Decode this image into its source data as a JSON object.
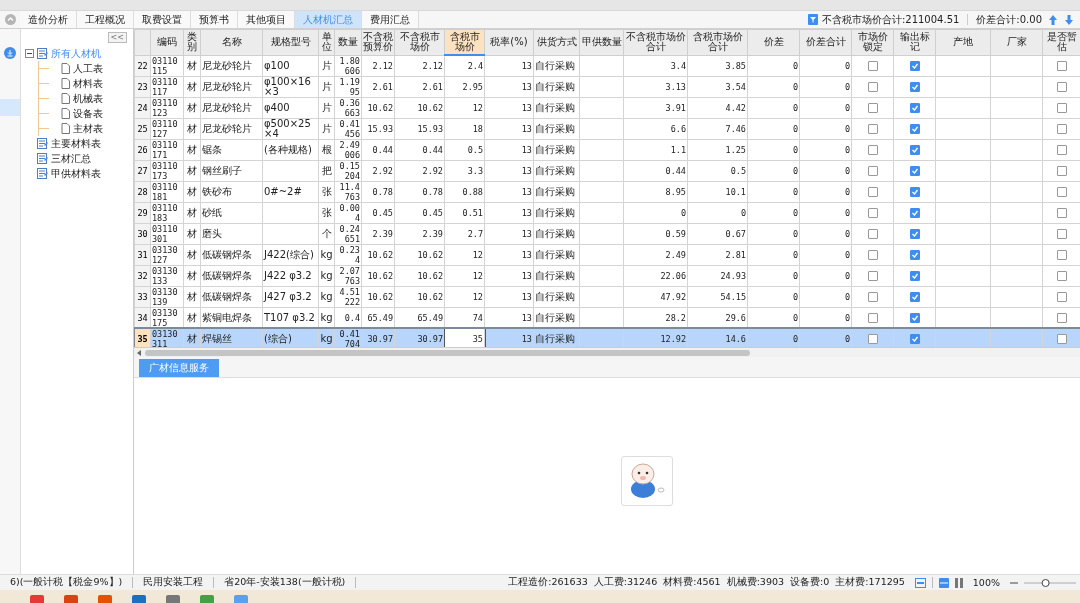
{
  "tabs": [
    {
      "label": "造价分析",
      "selected": false
    },
    {
      "label": "工程概况",
      "selected": false
    },
    {
      "label": "取费设置",
      "selected": false
    },
    {
      "label": "预算书",
      "selected": false
    },
    {
      "label": "其他项目",
      "selected": false
    },
    {
      "label": "人材机汇总",
      "selected": true
    },
    {
      "label": "费用汇总",
      "selected": false
    }
  ],
  "summary": {
    "market_total": "不含税市场价合计:211004.51",
    "diff_total": "价差合计:0.00"
  },
  "tree": {
    "collapse": "<<",
    "items": [
      {
        "label": "所有人材机",
        "selected": true,
        "expanded": true,
        "children": [
          {
            "label": "人工表",
            "selected": false
          },
          {
            "label": "材料表",
            "selected": false
          },
          {
            "label": "机械表",
            "selected": false
          },
          {
            "label": "设备表",
            "selected": false
          },
          {
            "label": "主材表",
            "selected": false
          }
        ]
      },
      {
        "label": "主要材料表",
        "selected": false
      },
      {
        "label": "三材汇总",
        "selected": false
      },
      {
        "label": "甲供材料表",
        "selected": false
      }
    ]
  },
  "table": {
    "columns": [
      {
        "label": "编码",
        "selected": false
      },
      {
        "label": "类别",
        "selected": false
      },
      {
        "label": "名称",
        "selected": false
      },
      {
        "label": "规格型号",
        "selected": false
      },
      {
        "label": "单位",
        "selected": false
      },
      {
        "label": "数量",
        "selected": false
      },
      {
        "label": "不含税预算价",
        "selected": false
      },
      {
        "label": "不含税市场价",
        "selected": false
      },
      {
        "label": "含税市场价",
        "selected": true
      },
      {
        "label": "税率(%)",
        "selected": false
      },
      {
        "label": "供货方式",
        "selected": false
      },
      {
        "label": "甲供数量",
        "selected": false
      },
      {
        "label": "不含税市场价合计",
        "selected": false
      },
      {
        "label": "含税市场价合计",
        "selected": false
      },
      {
        "label": "价差",
        "selected": false
      },
      {
        "label": "价差合计",
        "selected": false
      },
      {
        "label": "市场价锁定",
        "selected": false
      },
      {
        "label": "输出标记",
        "selected": false
      },
      {
        "label": "产地",
        "selected": false
      },
      {
        "label": "厂家",
        "selected": false
      },
      {
        "label": "是否暂估",
        "selected": false
      }
    ],
    "rows": [
      {
        "no": "22",
        "code": "03110115",
        "type": "材",
        "name": "尼龙砂轮片",
        "spec": "φ100",
        "unit": "片",
        "qty": "1.80606",
        "budget": "2.12",
        "market": "2.12",
        "market_tax": "2.4",
        "rate": "13",
        "supply": "自行采购",
        "total": "3.4",
        "total_tax": "3.85",
        "diff": "0",
        "diff_total": "0",
        "locked": false,
        "output": true,
        "provisional": false,
        "selected": false
      },
      {
        "no": "23",
        "code": "03110117",
        "type": "材",
        "name": "尼龙砂轮片",
        "spec": "φ100×16×3",
        "unit": "片",
        "qty": "1.1995",
        "budget": "2.61",
        "market": "2.61",
        "market_tax": "2.95",
        "rate": "13",
        "supply": "自行采购",
        "total": "3.13",
        "total_tax": "3.54",
        "diff": "0",
        "diff_total": "0",
        "locked": false,
        "output": true,
        "provisional": false,
        "selected": false
      },
      {
        "no": "24",
        "code": "03110123",
        "type": "材",
        "name": "尼龙砂轮片",
        "spec": "φ400",
        "unit": "片",
        "qty": "0.36663",
        "budget": "10.62",
        "market": "10.62",
        "market_tax": "12",
        "rate": "13",
        "supply": "自行采购",
        "total": "3.91",
        "total_tax": "4.42",
        "diff": "0",
        "diff_total": "0",
        "locked": false,
        "output": true,
        "provisional": false,
        "selected": false
      },
      {
        "no": "25",
        "code": "03110127",
        "type": "材",
        "name": "尼龙砂轮片",
        "spec": "φ500×25×4",
        "unit": "片",
        "qty": "0.41456",
        "budget": "15.93",
        "market": "15.93",
        "market_tax": "18",
        "rate": "13",
        "supply": "自行采购",
        "total": "6.6",
        "total_tax": "7.46",
        "diff": "0",
        "diff_total": "0",
        "locked": false,
        "output": true,
        "provisional": false,
        "selected": false
      },
      {
        "no": "26",
        "code": "03110171",
        "type": "材",
        "name": "锯条",
        "spec": "(各种规格)",
        "unit": "根",
        "qty": "2.49006",
        "budget": "0.44",
        "market": "0.44",
        "market_tax": "0.5",
        "rate": "13",
        "supply": "自行采购",
        "total": "1.1",
        "total_tax": "1.25",
        "diff": "0",
        "diff_total": "0",
        "locked": false,
        "output": true,
        "provisional": false,
        "selected": false
      },
      {
        "no": "27",
        "code": "03110173",
        "type": "材",
        "name": "钢丝刷子",
        "unit": "把",
        "qty": "0.15204",
        "budget": "2.92",
        "market": "2.92",
        "market_tax": "3.3",
        "rate": "13",
        "supply": "自行采购",
        "total": "0.44",
        "total_tax": "0.5",
        "diff": "0",
        "diff_total": "0",
        "locked": false,
        "output": true,
        "provisional": false,
        "selected": false
      },
      {
        "no": "28",
        "code": "03110181",
        "type": "材",
        "name": "铁砂布",
        "spec": "0#~2#",
        "unit": "张",
        "qty": "11.4763",
        "budget": "0.78",
        "market": "0.78",
        "market_tax": "0.88",
        "rate": "13",
        "supply": "自行采购",
        "total": "8.95",
        "total_tax": "10.1",
        "diff": "0",
        "diff_total": "0",
        "locked": false,
        "output": true,
        "provisional": false,
        "selected": false
      },
      {
        "no": "29",
        "code": "03110183",
        "type": "材",
        "name": "砂纸",
        "unit": "张",
        "qty": "0.004",
        "budget": "0.45",
        "market": "0.45",
        "market_tax": "0.51",
        "rate": "13",
        "supply": "自行采购",
        "total": "0",
        "total_tax": "0",
        "diff": "0",
        "diff_total": "0",
        "locked": false,
        "output": true,
        "provisional": false,
        "selected": false
      },
      {
        "no": "30",
        "code": "03110301",
        "type": "材",
        "name": "磨头",
        "unit": "个",
        "qty": "0.24651",
        "budget": "2.39",
        "market": "2.39",
        "market_tax": "2.7",
        "rate": "13",
        "supply": "自行采购",
        "total": "0.59",
        "total_tax": "0.67",
        "diff": "0",
        "diff_total": "0",
        "locked": false,
        "output": true,
        "provisional": false,
        "selected": false
      },
      {
        "no": "31",
        "code": "03130127",
        "type": "材",
        "name": "低碳钢焊条",
        "spec": "J422(综合)",
        "unit": "kg",
        "qty": "0.234",
        "budget": "10.62",
        "market": "10.62",
        "market_tax": "12",
        "rate": "13",
        "supply": "自行采购",
        "total": "2.49",
        "total_tax": "2.81",
        "diff": "0",
        "diff_total": "0",
        "locked": false,
        "output": true,
        "provisional": false,
        "selected": false
      },
      {
        "no": "32",
        "code": "03130133",
        "type": "材",
        "name": "低碳钢焊条",
        "spec": "J422 φ3.2",
        "unit": "kg",
        "qty": "2.07763",
        "budget": "10.62",
        "market": "10.62",
        "market_tax": "12",
        "rate": "13",
        "supply": "自行采购",
        "total": "22.06",
        "total_tax": "24.93",
        "diff": "0",
        "diff_total": "0",
        "locked": false,
        "output": true,
        "provisional": false,
        "selected": false
      },
      {
        "no": "33",
        "code": "03130139",
        "type": "材",
        "name": "低碳钢焊条",
        "spec": "J427 φ3.2",
        "unit": "kg",
        "qty": "4.51222",
        "budget": "10.62",
        "market": "10.62",
        "market_tax": "12",
        "rate": "13",
        "supply": "自行采购",
        "total": "47.92",
        "total_tax": "54.15",
        "diff": "0",
        "diff_total": "0",
        "locked": false,
        "output": true,
        "provisional": false,
        "selected": false
      },
      {
        "no": "34",
        "code": "03130175",
        "type": "材",
        "name": "紫铜电焊条",
        "spec": "T107 φ3.2",
        "unit": "kg",
        "qty": "0.4",
        "budget": "65.49",
        "market": "65.49",
        "market_tax": "74",
        "rate": "13",
        "supply": "自行采购",
        "total": "28.2",
        "total_tax": "29.6",
        "diff": "0",
        "diff_total": "0",
        "locked": false,
        "output": true,
        "provisional": false,
        "selected": false
      },
      {
        "no": "35",
        "code": "03130311",
        "type": "材",
        "name": "焊锡丝",
        "spec": "(综合)",
        "unit": "kg",
        "qty": "0.41704",
        "budget": "30.97",
        "market": "30.97",
        "market_tax": "35",
        "rate": "13",
        "supply": "自行采购",
        "total": "12.92",
        "total_tax": "14.6",
        "diff": "0",
        "diff_total": "0",
        "locked": false,
        "output": true,
        "provisional": false,
        "selected": true
      }
    ]
  },
  "bottom_tabs": [
    {
      "label": "广材信息服务",
      "selected": true
    }
  ],
  "status_bar": {
    "left": [
      "6)(一般计税【税金9%】)",
      "民用安装工程",
      "省20年-安装138(一般计税)"
    ],
    "costs": "工程造价:261633  人工费:31246  材料费:4561  机械费:3903  设备费:0  主材费:171295",
    "zoom": "100%",
    "zoom_slider": {
      "level": 0.4
    }
  }
}
